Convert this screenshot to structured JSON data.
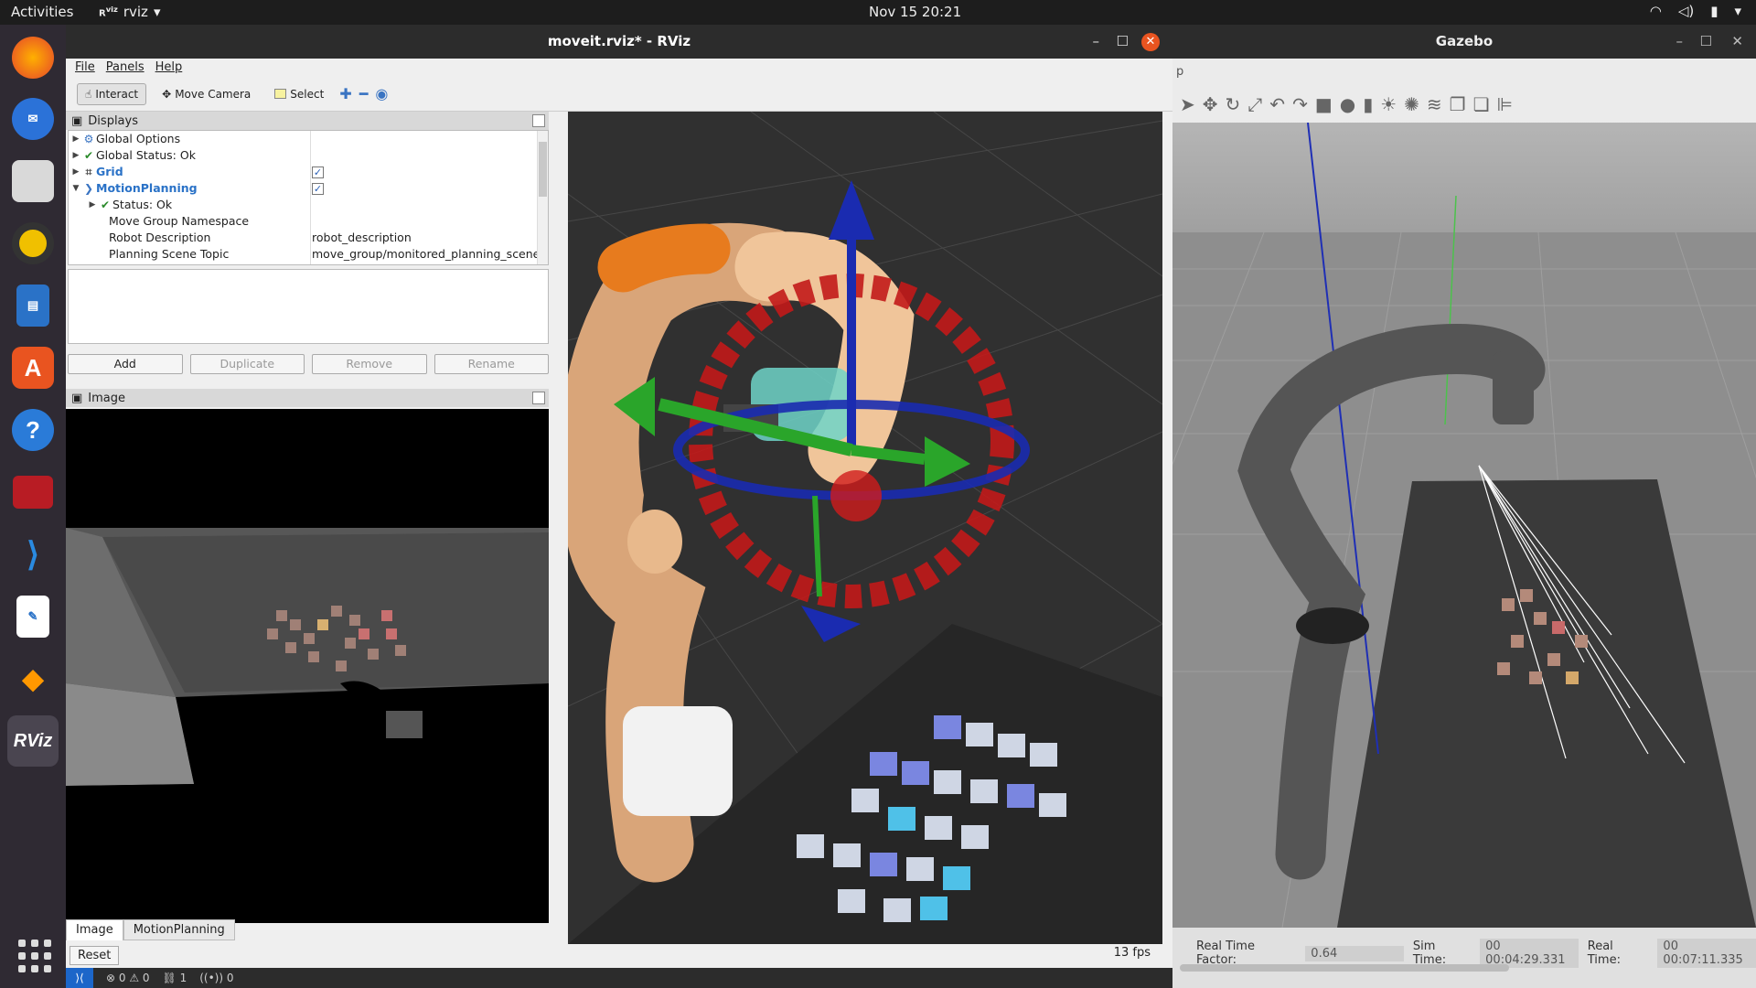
{
  "topbar": {
    "activities": "Activities",
    "app_name": "rviz",
    "app_arrow": "▾",
    "clock": "Nov 15  20:21"
  },
  "dock": {
    "items": [
      "firefox-icon",
      "thunderbird-icon",
      "files-icon",
      "rhythmbox-icon",
      "writer-icon",
      "app-center-icon",
      "help-icon",
      "terminal-icon",
      "vscode-icon",
      "text-editor-icon",
      "sublime-icon",
      "rviz-icon"
    ],
    "rviz_label": "RViz"
  },
  "rviz": {
    "title": "moveit.rviz* - RViz",
    "menu": {
      "file": "File",
      "panels": "Panels",
      "help": "Help"
    },
    "toolbar": {
      "interact": "Interact",
      "move_camera": "Move Camera",
      "select": "Select"
    },
    "displays": {
      "title": "Displays",
      "rows": [
        {
          "label": "Global Options"
        },
        {
          "label": "Global Status: Ok"
        },
        {
          "label": "Grid"
        },
        {
          "label": "MotionPlanning"
        },
        {
          "label": "Status: Ok"
        },
        {
          "label": "Move Group Namespace",
          "value": ""
        },
        {
          "label": "Robot Description",
          "value": "robot_description"
        },
        {
          "label": "Planning Scene Topic",
          "value": "move_group/monitored_planning_scene"
        }
      ],
      "buttons": {
        "add": "Add",
        "duplicate": "Duplicate",
        "remove": "Remove",
        "rename": "Rename"
      }
    },
    "image_panel": {
      "title": "Image"
    },
    "bottom_tabs": {
      "image": "Image",
      "motion_planning": "MotionPlanning"
    },
    "reset": "Reset",
    "fps": "13 fps"
  },
  "gazebo": {
    "title": "Gazebo",
    "menu_fragment": "p",
    "status": {
      "rtf_label": "Real Time Factor:",
      "rtf_value": "0.64",
      "sim_time_label": "Sim Time:",
      "sim_time_value": "00 00:04:29.331",
      "real_time_label": "Real Time:",
      "real_time_value": "00 00:07:11.335"
    }
  },
  "statusbar": {
    "errors": "⊗ 0 ⚠ 0",
    "ports": "1",
    "radio": "0"
  }
}
